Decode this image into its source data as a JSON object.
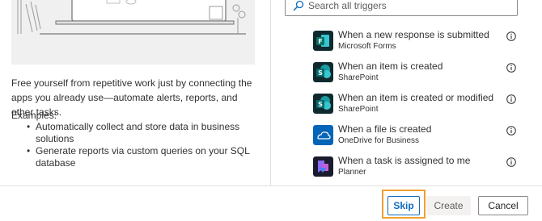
{
  "description": "Free yourself from repetitive work just by connecting the apps you already use—automate alerts, reports, and other tasks.",
  "examples": {
    "title": "Examples:",
    "items": [
      "Automatically collect and store data in business solutions",
      "Generate reports via custom queries on your SQL database"
    ]
  },
  "search": {
    "placeholder": "Search all triggers"
  },
  "triggers": [
    {
      "title": "When a new response is submitted",
      "connector": "Microsoft Forms",
      "icon": "microsoft-forms-icon",
      "color": "#077568"
    },
    {
      "title": "When an item is created",
      "connector": "SharePoint",
      "icon": "sharepoint-icon",
      "color": "#036c70"
    },
    {
      "title": "When an item is created or modified",
      "connector": "SharePoint",
      "icon": "sharepoint-icon",
      "color": "#036c70"
    },
    {
      "title": "When a file is created",
      "connector": "OneDrive for Business",
      "icon": "onedrive-icon",
      "color": "#0364b8"
    },
    {
      "title": "When a task is assigned to me",
      "connector": "Planner",
      "icon": "planner-icon",
      "color": "#31752f"
    }
  ],
  "footer": {
    "skip_label": "Skip",
    "create_label": "Create",
    "cancel_label": "Cancel"
  },
  "colors": {
    "accent": "#0f6cbd",
    "highlight": "#f0a030",
    "divider": "#e1dfdd"
  }
}
